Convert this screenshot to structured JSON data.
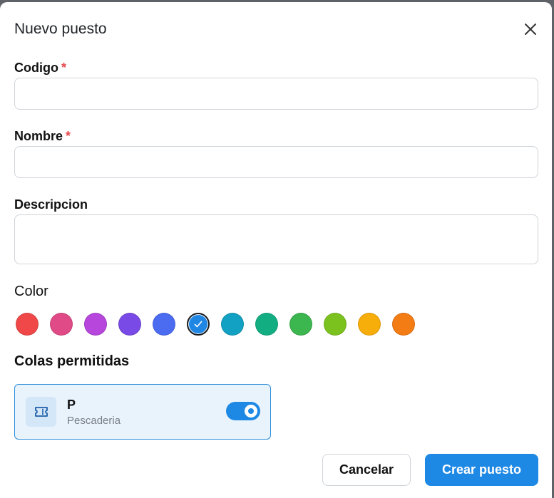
{
  "dialog": {
    "title": "Nuevo puesto"
  },
  "form": {
    "codigo": {
      "label": "Codigo",
      "required_mark": "*",
      "value": "",
      "placeholder": ""
    },
    "nombre": {
      "label": "Nombre",
      "required_mark": "*",
      "value": "",
      "placeholder": ""
    },
    "descripcion": {
      "label": "Descripcion",
      "value": "",
      "placeholder": ""
    }
  },
  "color": {
    "label": "Color",
    "selected_index": 5,
    "swatches": [
      {
        "name": "red",
        "hex": "#f04848"
      },
      {
        "name": "pink",
        "hex": "#e04a86"
      },
      {
        "name": "purple",
        "hex": "#b646dc"
      },
      {
        "name": "violet",
        "hex": "#7a4ae6"
      },
      {
        "name": "blue",
        "hex": "#4b6cf0"
      },
      {
        "name": "sky-blue",
        "hex": "#1f86e3"
      },
      {
        "name": "cyan",
        "hex": "#12a1c2"
      },
      {
        "name": "teal",
        "hex": "#12ae82"
      },
      {
        "name": "green",
        "hex": "#3cb64e"
      },
      {
        "name": "lime",
        "hex": "#7cc21f"
      },
      {
        "name": "amber",
        "hex": "#f8ae0a"
      },
      {
        "name": "orange",
        "hex": "#f47c14"
      }
    ]
  },
  "queues": {
    "title": "Colas permitidas",
    "items": [
      {
        "code": "P",
        "name": "Pescaderia",
        "enabled": true,
        "icon": "ticket-icon"
      }
    ]
  },
  "actions": {
    "cancel_label": "Cancelar",
    "submit_label": "Crear puesto"
  },
  "theme": {
    "accent": "#1e88e5",
    "required": "#e5484d"
  }
}
